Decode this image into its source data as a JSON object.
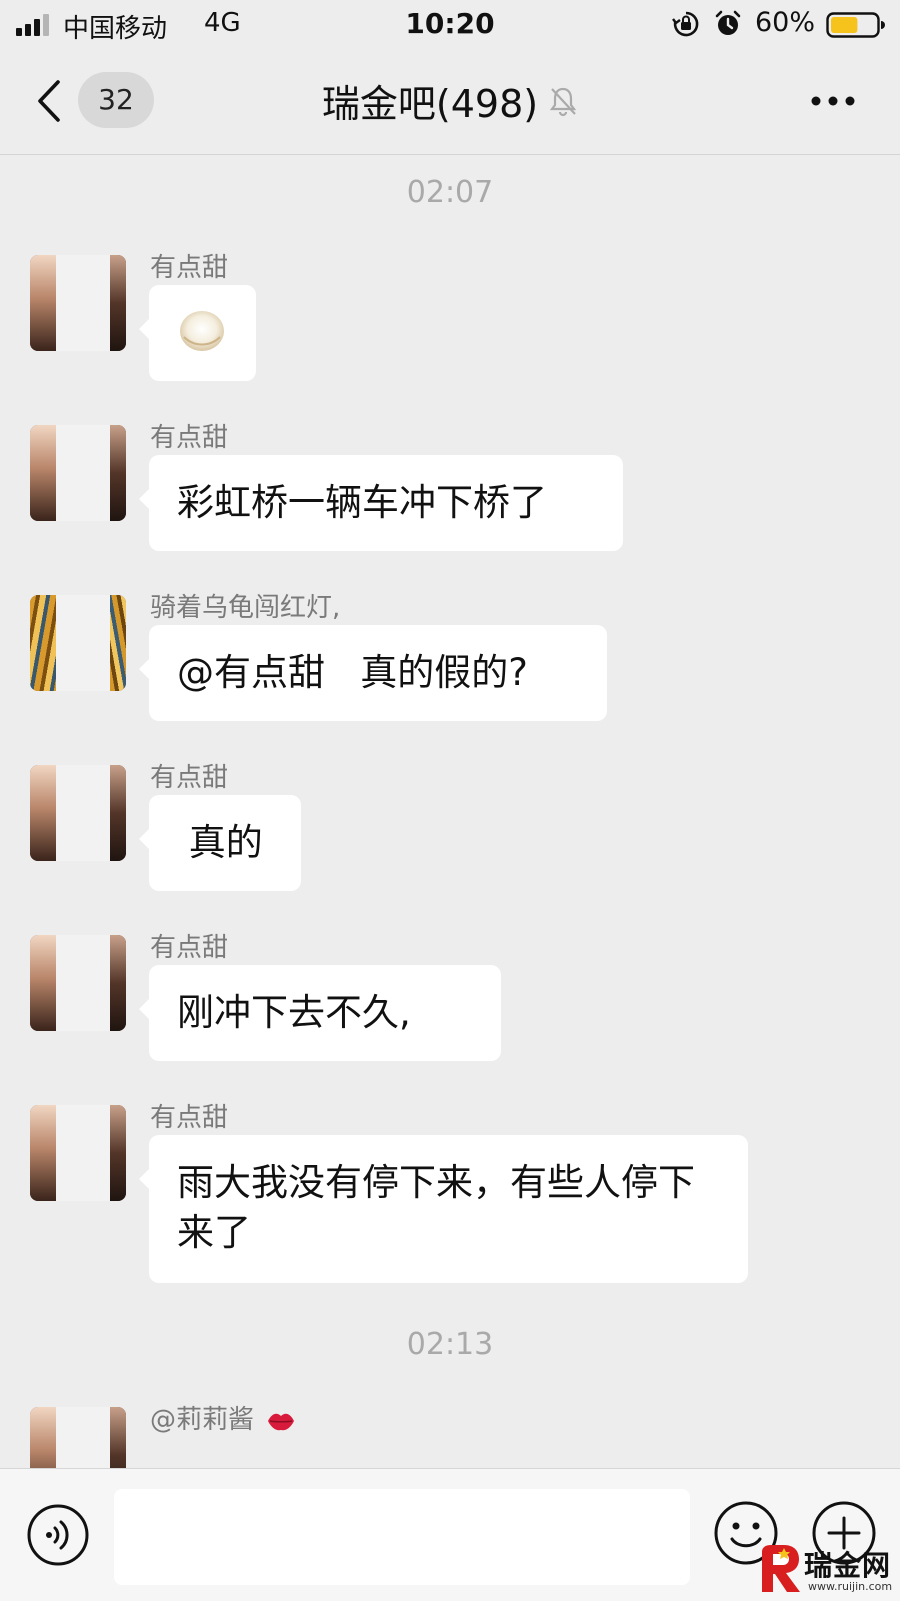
{
  "status_bar": {
    "carrier": "中国移动",
    "network": "4G",
    "time": "10:20",
    "battery_percent": "60%",
    "battery_level": 0.6,
    "battery_color": "#f5c31c"
  },
  "nav": {
    "unread_count": "32",
    "title": "瑞金吧(498)",
    "muted": true
  },
  "chat": {
    "timestamps": [
      "02:07",
      "02:13"
    ],
    "messages": [
      {
        "sender": "有点甜",
        "type": "sticker",
        "text": ""
      },
      {
        "sender": "有点甜",
        "type": "text",
        "text": "彩虹桥一辆车冲下桥了"
      },
      {
        "sender": "骑着乌龟闯红灯,",
        "type": "text",
        "text": "@有点甜   真的假的?"
      },
      {
        "sender": "有点甜",
        "type": "text",
        "text": " 真的"
      },
      {
        "sender": "有点甜",
        "type": "text",
        "text": "刚冲下去不久,"
      },
      {
        "sender": "有点甜",
        "type": "text",
        "text": "雨大我没有停下来，有些人停下来了"
      },
      {
        "sender": "@莉莉酱",
        "type": "partial",
        "text": ""
      }
    ]
  },
  "input": {
    "value": "",
    "placeholder": ""
  },
  "watermark": {
    "name": "瑞金网",
    "url": "www.ruijin.com"
  },
  "colors": {
    "background": "#ededed",
    "bubble": "#ffffff",
    "timestamp_text": "#a9a9a9",
    "sender_text": "#7a7a7a"
  }
}
